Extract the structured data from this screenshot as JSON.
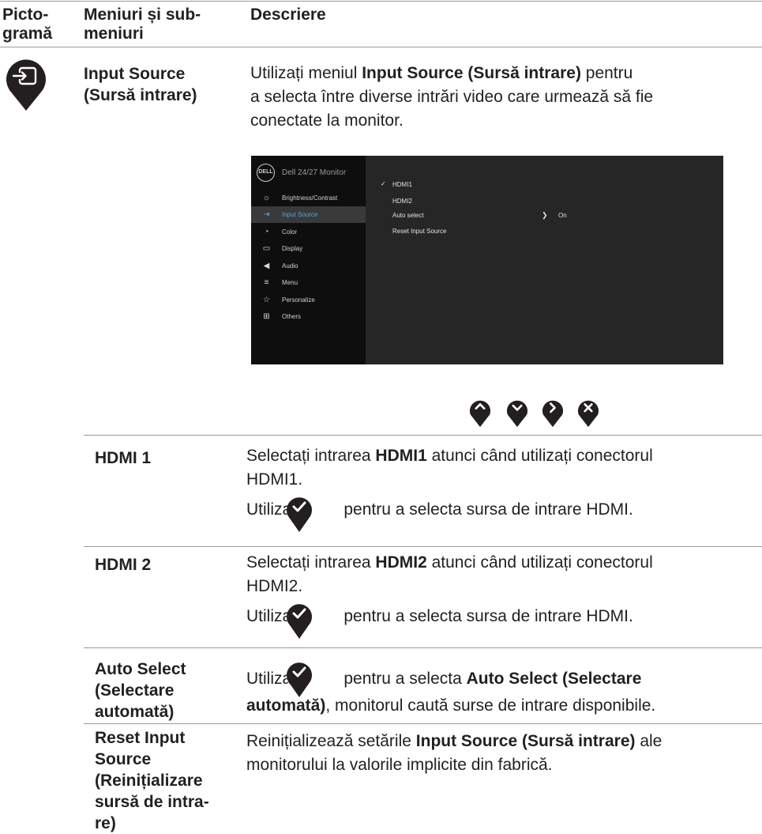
{
  "header": {
    "col1": [
      "Picto-",
      "gramă"
    ],
    "col2": [
      "Meniuri și sub-",
      "meniuri"
    ],
    "col3": "Descriere"
  },
  "main": {
    "title": [
      "Input Source",
      "(Sursă intrare)"
    ],
    "intro": {
      "pre": "Utilizați meniul ",
      "bold": "Input Source (Sursă intrare)",
      "post": " pentru",
      "line2": "a selecta între diverse intrări video care urmează să fie",
      "line3": "conectate la monitor."
    }
  },
  "osd": {
    "logo": "DELL",
    "title": "Dell 24/27 Monitor",
    "menu": [
      {
        "icon": "brightness-icon",
        "glyph": "☼",
        "label": "Brightness/Contrast"
      },
      {
        "icon": "input-source-icon",
        "glyph": "⇥",
        "label": "Input Source",
        "selected": true
      },
      {
        "icon": "color-icon",
        "glyph": "◔",
        "label": "Color"
      },
      {
        "icon": "display-icon",
        "glyph": "▭",
        "label": "Display"
      },
      {
        "icon": "audio-icon",
        "glyph": "◀",
        "label": "Audio"
      },
      {
        "icon": "menu-icon",
        "glyph": "≡",
        "label": "Menu"
      },
      {
        "icon": "personalize-icon",
        "glyph": "☆",
        "label": "Personalize"
      },
      {
        "icon": "others-icon",
        "glyph": "⊞",
        "label": "Others"
      }
    ],
    "options": [
      "HDMI1",
      "HDMI2",
      "Auto select",
      "Reset Input Source"
    ],
    "checked_glyph": "✓",
    "auto_select_value": "On",
    "arrow_glyph": "❯",
    "accent": "#4ea7e3"
  },
  "nav_buttons": [
    {
      "icon": "up-icon",
      "glyph": "⌃"
    },
    {
      "icon": "down-icon",
      "glyph": "⌄"
    },
    {
      "icon": "right-icon",
      "glyph": "›"
    },
    {
      "icon": "close-icon",
      "glyph": "×"
    }
  ],
  "rows": [
    {
      "name": [
        "HDMI 1"
      ],
      "line1_pre": "Selectați intrarea ",
      "line1_bold": "HDMI1",
      "line1_post": " atunci când utilizați conectorul",
      "line2": "HDMI1.",
      "line3_pre": "Utilizați ",
      "line3_post": " pentru a selecta sursa de intrare HDMI."
    },
    {
      "name": [
        "HDMI 2"
      ],
      "line1_pre": "Selectați intrarea ",
      "line1_bold": "HDMI2",
      "line1_post": " atunci când utilizați conectorul",
      "line2": "HDMI2.",
      "line3_pre": "Utilizați ",
      "line3_post": " pentru a selecta sursa de intrare HDMI."
    },
    {
      "name": [
        "Auto Select",
        "(Selectare",
        "automată)"
      ],
      "line1_pre": "Utilizați ",
      "line1_mid": " pentru a selecta ",
      "line1_bold": "Auto Select (Selectare",
      "line2_bold": "automată)",
      "line2_post": ", monitorul caută surse de intrare disponibile."
    },
    {
      "name": [
        "Reset Input",
        "Source",
        "(Reinițializare",
        "sursă de intra-",
        "re)"
      ],
      "line1_pre": "Reinițializează setările ",
      "line1_bold": "Input Source (Sursă intrare)",
      "line1_post": " ale",
      "line2": "monitorului la valorile implicite din fabrică."
    }
  ],
  "colors": {
    "pin": "#231f20",
    "rule": "#9a9a9a",
    "osd_bg": "#262626",
    "osd_side": "#0e0e0e"
  }
}
